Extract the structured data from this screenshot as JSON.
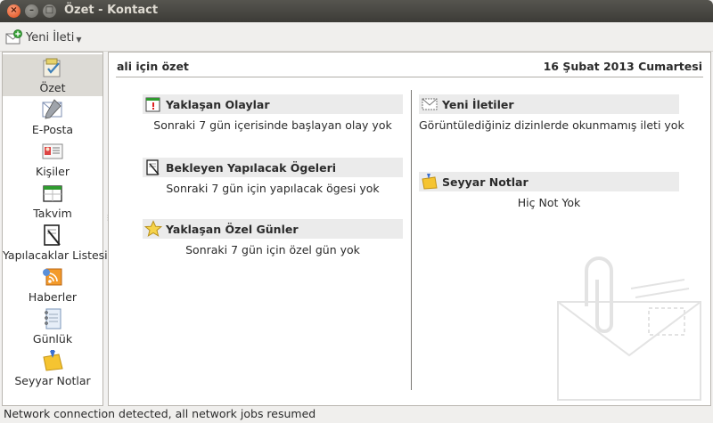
{
  "window": {
    "title": "Özet - Kontact"
  },
  "toolbar": {
    "new_message_label": "Yeni İleti"
  },
  "sidebar": {
    "items": [
      {
        "label": "Özet",
        "icon": "summary-icon"
      },
      {
        "label": "E-Posta",
        "icon": "mail-icon"
      },
      {
        "label": "Kişiler",
        "icon": "contacts-icon"
      },
      {
        "label": "Takvim",
        "icon": "calendar-icon"
      },
      {
        "label": "Yapılacaklar Listesi",
        "icon": "todo-icon"
      },
      {
        "label": "Haberler",
        "icon": "feeds-icon"
      },
      {
        "label": "Günlük",
        "icon": "journal-icon"
      },
      {
        "label": "Seyyar Notlar",
        "icon": "notes-icon"
      }
    ]
  },
  "summary": {
    "header_left": "ali için özet",
    "header_right": "16 Şubat 2013 Cumartesi",
    "sections": {
      "upcoming_events": {
        "title": "Yaklaşan Olaylar",
        "body": "Sonraki 7 gün içerisinde başlayan olay yok"
      },
      "pending_todos": {
        "title": "Bekleyen Yapılacak Ögeleri",
        "body": "Sonraki 7 gün için yapılacak ögesi yok"
      },
      "special_dates": {
        "title": "Yaklaşan Özel Günler",
        "body": "Sonraki 7 gün için özel gün yok"
      },
      "new_messages": {
        "title": "Yeni İletiler",
        "body": "Görüntülediğiniz dizinlerde okunmamış ileti yok"
      },
      "notes": {
        "title": "Seyyar Notlar",
        "body": "Hiç Not Yok"
      }
    }
  },
  "status": {
    "text": "Network connection detected, all network jobs resumed"
  },
  "colors": {
    "titlebar": "#3c3b37",
    "close_button": "#df4a16",
    "active_item": "#dcdad5",
    "section_header": "#ebebeb"
  }
}
